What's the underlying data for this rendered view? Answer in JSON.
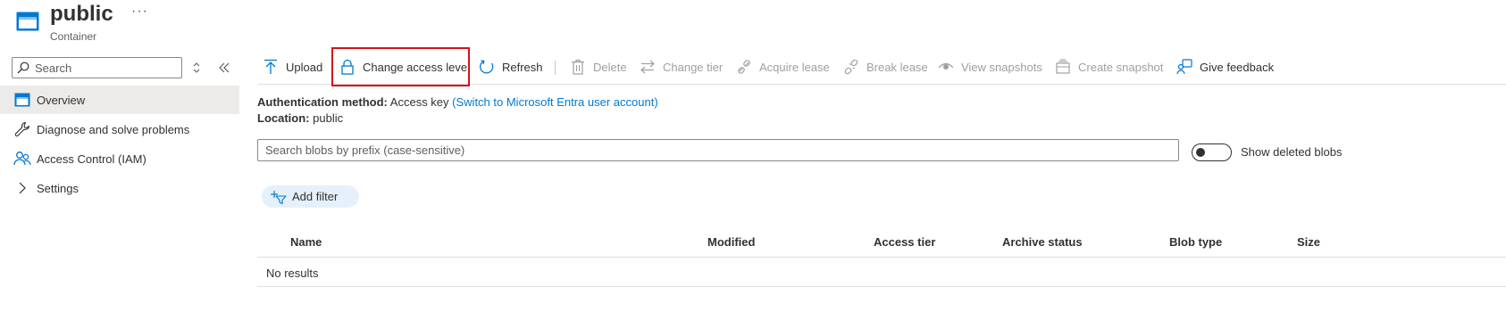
{
  "header": {
    "title": "public",
    "subtitle": "Container",
    "more": "···"
  },
  "sidebar": {
    "search_placeholder": "Search",
    "items": [
      {
        "label": "Overview",
        "icon": "container-icon",
        "active": true
      },
      {
        "label": "Diagnose and solve problems",
        "icon": "wrench-icon"
      },
      {
        "label": "Access Control (IAM)",
        "icon": "people-icon"
      },
      {
        "label": "Settings",
        "icon": "chevron-right-icon"
      }
    ]
  },
  "toolbar": {
    "upload": "Upload",
    "change_access_level": "Change access level",
    "refresh": "Refresh",
    "delete": "Delete",
    "change_tier": "Change tier",
    "acquire_lease": "Acquire lease",
    "break_lease": "Break lease",
    "view_snapshots": "View snapshots",
    "create_snapshot": "Create snapshot",
    "give_feedback": "Give feedback"
  },
  "info": {
    "auth_label": "Authentication method:",
    "auth_value": "Access key",
    "auth_link": "(Switch to Microsoft Entra user account)",
    "location_label": "Location:",
    "location_value": "public"
  },
  "blob_search": {
    "placeholder": "Search blobs by prefix (case-sensitive)"
  },
  "show_deleted": {
    "label": "Show deleted blobs",
    "enabled": false
  },
  "filter": {
    "add_filter": "Add filter"
  },
  "table": {
    "columns": [
      "Name",
      "Modified",
      "Access tier",
      "Archive status",
      "Blob type",
      "Size"
    ],
    "empty_text": "No results"
  },
  "colors": {
    "accent": "#0078d4",
    "highlight": "#d1141b",
    "disabled": "#a19f9d",
    "active_nav": "#edebe9"
  }
}
